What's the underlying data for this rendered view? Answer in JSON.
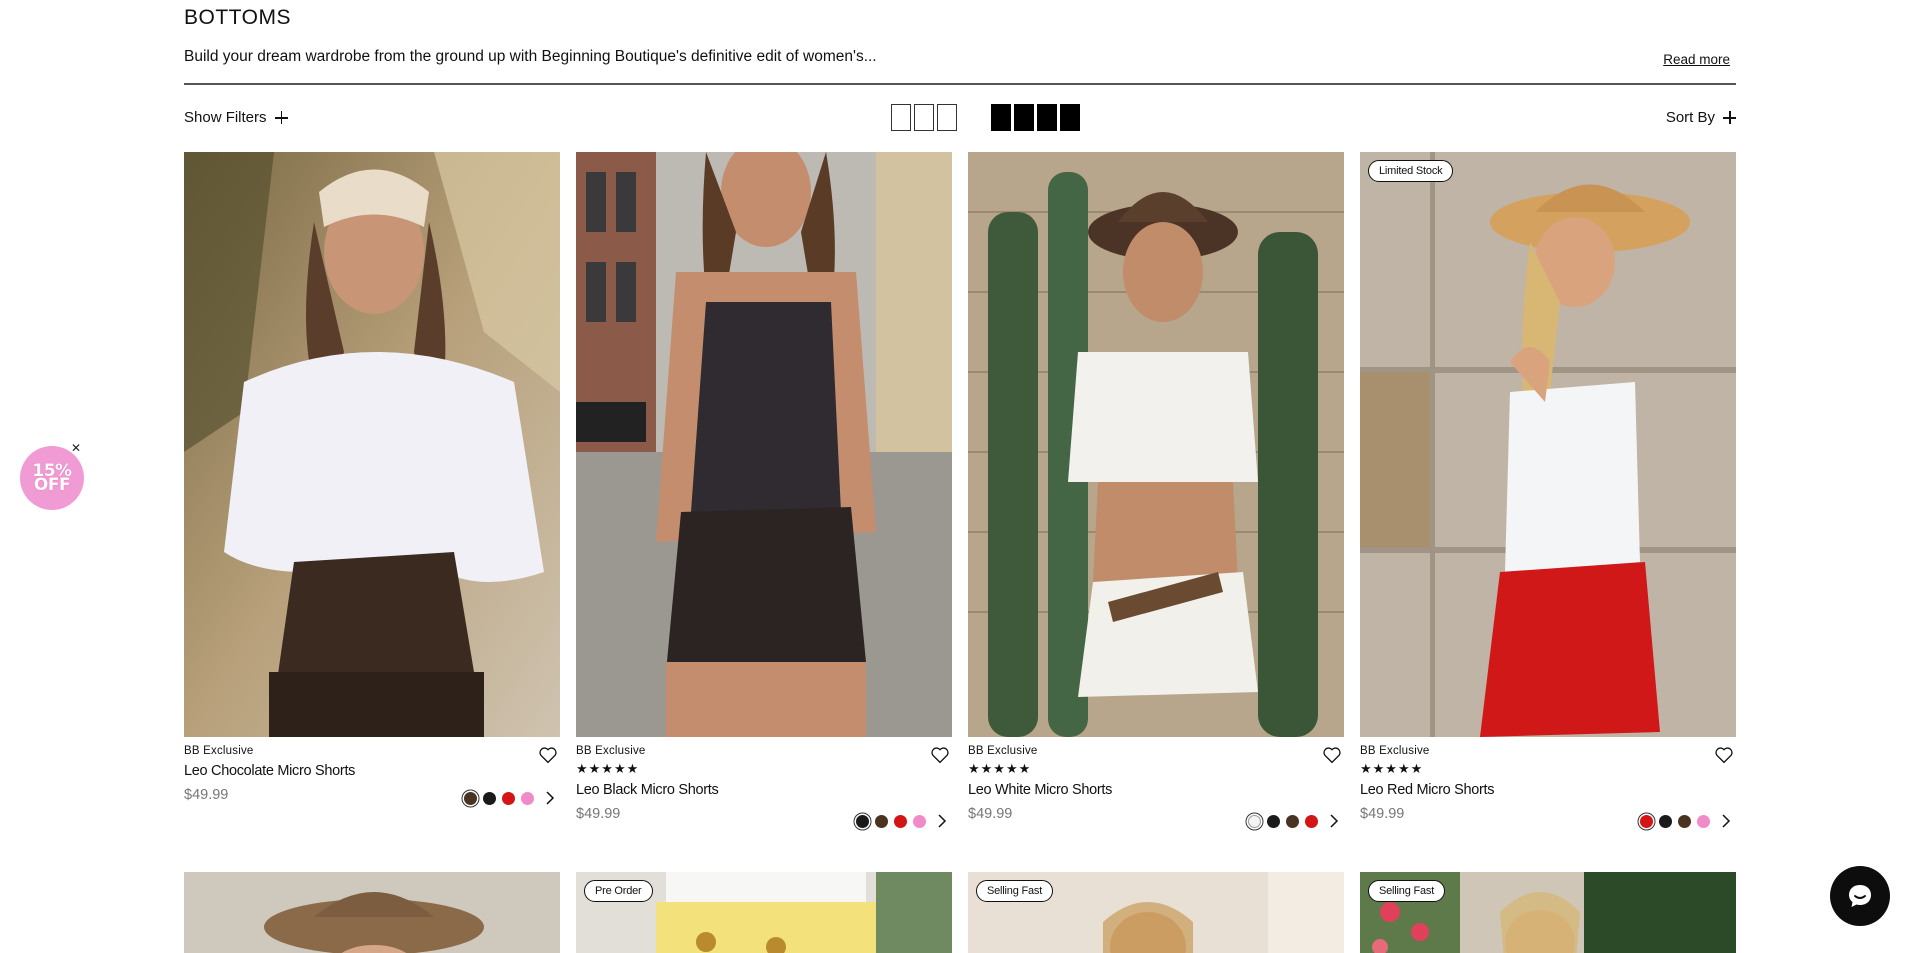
{
  "page": {
    "title": "BOTTOMS",
    "description": "Build your dream wardrobe from the ground up with Beginning Boutique's definitive edit of women's...",
    "read_more": "Read more"
  },
  "toolbar": {
    "show_filters": "Show Filters",
    "sort_by": "Sort By",
    "grid_options": [
      "3-column grid",
      "4-column grid"
    ],
    "grid_selected": "4-column grid"
  },
  "products": [
    {
      "badge": "",
      "tag": "BB Exclusive",
      "stars": "",
      "name": "Leo Chocolate Micro Shorts",
      "price": "$49.99",
      "swatches": [
        "#4a3320",
        "#1a1a1a",
        "#d41515",
        "#f08ac8"
      ],
      "selected_swatch": 0
    },
    {
      "badge": "",
      "tag": "BB Exclusive",
      "stars": "★★★★★",
      "name": "Leo Black Micro Shorts",
      "price": "$49.99",
      "swatches": [
        "#1a1a1a",
        "#4a3320",
        "#d41515",
        "#f08ac8"
      ],
      "selected_swatch": 0
    },
    {
      "badge": "",
      "tag": "BB Exclusive",
      "stars": "★★★★★",
      "name": "Leo White Micro Shorts",
      "price": "$49.99",
      "swatches": [
        "#f4f4f4",
        "#1a1a1a",
        "#4a3320",
        "#d41515"
      ],
      "selected_swatch": 0
    },
    {
      "badge": "Limited Stock",
      "tag": "BB Exclusive",
      "stars": "★★★★★",
      "name": "Leo Red Micro Shorts",
      "price": "$49.99",
      "swatches": [
        "#d41515",
        "#1a1a1a",
        "#4a3320",
        "#f08ac8"
      ],
      "selected_swatch": 0
    }
  ],
  "products_row2": [
    {
      "badge": ""
    },
    {
      "badge": "Pre Order"
    },
    {
      "badge": "Selling Fast"
    },
    {
      "badge": "Selling Fast"
    }
  ],
  "promo": {
    "line1": "15%",
    "line2": "OFF",
    "close": "✕"
  },
  "colors": {
    "promo_pink": "#f19bd5",
    "chat_bg": "#0d0d0d"
  }
}
